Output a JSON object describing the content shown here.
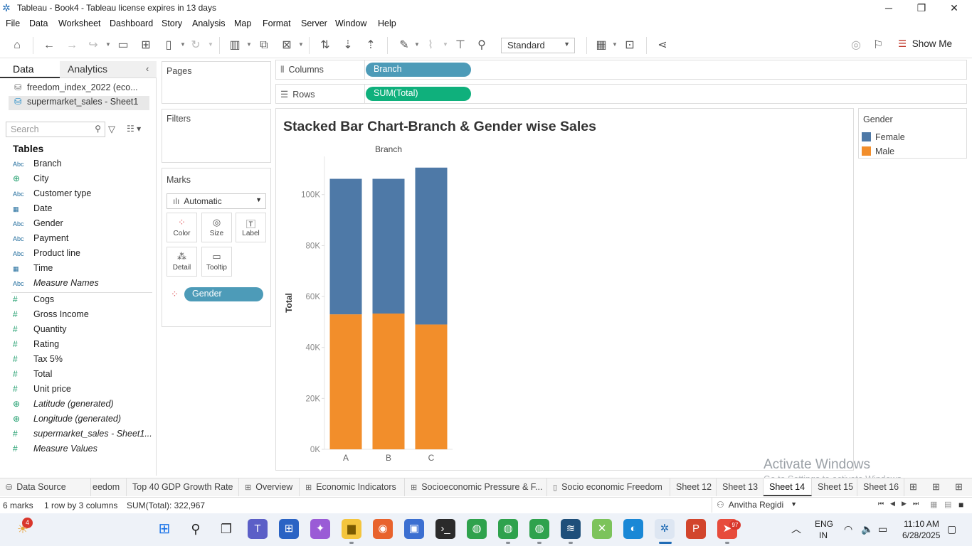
{
  "window": {
    "title": "Tableau - Book4 - Tableau license expires in 13 days"
  },
  "menu": [
    "File",
    "Data",
    "Worksheet",
    "Dashboard",
    "Story",
    "Analysis",
    "Map",
    "Format",
    "Server",
    "Window",
    "Help"
  ],
  "toolbar": {
    "fit_select": "Standard",
    "show_me": "Show Me"
  },
  "left_pane": {
    "tabs": {
      "data": "Data",
      "analytics": "Analytics"
    },
    "datasources": [
      "freedom_index_2022 (eco...",
      "supermarket_sales - Sheet1"
    ],
    "search_placeholder": "Search",
    "tables_heading": "Tables",
    "dimensions": [
      {
        "type": "Abc",
        "name": "Branch"
      },
      {
        "type": "globe",
        "name": "City"
      },
      {
        "type": "Abc",
        "name": "Customer type"
      },
      {
        "type": "calendar",
        "name": "Date"
      },
      {
        "type": "Abc",
        "name": "Gender"
      },
      {
        "type": "Abc",
        "name": "Payment"
      },
      {
        "type": "Abc",
        "name": "Product line"
      },
      {
        "type": "calendar",
        "name": "Time"
      },
      {
        "type": "Abc",
        "name": "Measure Names"
      }
    ],
    "measures": [
      {
        "type": "#",
        "name": "Cogs"
      },
      {
        "type": "#",
        "name": "Gross Income"
      },
      {
        "type": "#",
        "name": "Quantity"
      },
      {
        "type": "#",
        "name": "Rating"
      },
      {
        "type": "#",
        "name": "Tax 5%"
      },
      {
        "type": "#",
        "name": "Total"
      },
      {
        "type": "#",
        "name": "Unit price"
      },
      {
        "type": "globe",
        "name": "Latitude (generated)"
      },
      {
        "type": "globe",
        "name": "Longitude (generated)"
      },
      {
        "type": "#",
        "name": "supermarket_sales - Sheet1..."
      },
      {
        "type": "#",
        "name": "Measure Values"
      }
    ]
  },
  "cards": {
    "pages": "Pages",
    "filters": "Filters",
    "marks": "Marks",
    "marks_type": "Automatic",
    "mark_buttons": [
      "Color",
      "Size",
      "Label",
      "Detail",
      "Tooltip"
    ],
    "color_pill": "Gender"
  },
  "shelves": {
    "columns_label": "Columns",
    "columns_pill": "Branch",
    "rows_label": "Rows",
    "rows_pill": "SUM(Total)"
  },
  "sheet": {
    "title": "Stacked Bar Chart-Branch & Gender wise Sales"
  },
  "legend": {
    "title": "Gender",
    "items": [
      {
        "name": "Female",
        "color": "#4e79a7"
      },
      {
        "name": "Male",
        "color": "#f28e2b"
      }
    ]
  },
  "chart_data": {
    "type": "bar",
    "stacked": true,
    "title": "Stacked Bar Chart-Branch & Gender wise Sales",
    "xlabel": "Branch",
    "ylabel": "Total",
    "categories": [
      "A",
      "B",
      "C"
    ],
    "series": [
      {
        "name": "Male",
        "color": "#f28e2b",
        "values": [
          53000,
          53300,
          49000
        ]
      },
      {
        "name": "Female",
        "color": "#4e79a7",
        "values": [
          53200,
          52900,
          61600
        ]
      }
    ],
    "ylim": [
      0,
      115000
    ],
    "yticks": [
      0,
      20000,
      40000,
      60000,
      80000,
      100000
    ],
    "ytick_labels": [
      "0K",
      "20K",
      "40K",
      "60K",
      "80K",
      "100K"
    ],
    "grid": false
  },
  "watermark": {
    "line1": "Activate Windows",
    "line2": "Go to Settings to activate Windows."
  },
  "sheet_tabs": [
    {
      "label": "Data Source",
      "icon": "database"
    },
    {
      "label": "eedom",
      "icon": ""
    },
    {
      "label": "Top 40 GDP Growth Rate",
      "icon": ""
    },
    {
      "label": "Overview",
      "icon": "dashboard"
    },
    {
      "label": "Economic Indicators",
      "icon": "dashboard"
    },
    {
      "label": "Socioeconomic Pressure & F...",
      "icon": "dashboard"
    },
    {
      "label": "Socio economic Freedom",
      "icon": "story"
    },
    {
      "label": "Sheet 12",
      "icon": ""
    },
    {
      "label": "Sheet 13",
      "icon": ""
    },
    {
      "label": "Sheet 14",
      "icon": ""
    },
    {
      "label": "Sheet 15",
      "icon": ""
    },
    {
      "label": "Sheet 16",
      "icon": ""
    }
  ],
  "status": {
    "marks": "6 marks",
    "rows_cols": "1 row by 3 columns",
    "sum": "SUM(Total): 322,967",
    "user": "Anvitha  Regidi"
  },
  "taskbar": {
    "weather_badge": "4",
    "telegram_badge": "97",
    "lang1": "ENG",
    "lang2": "IN",
    "time": "11:10 AM",
    "date": "6/28/2025"
  }
}
